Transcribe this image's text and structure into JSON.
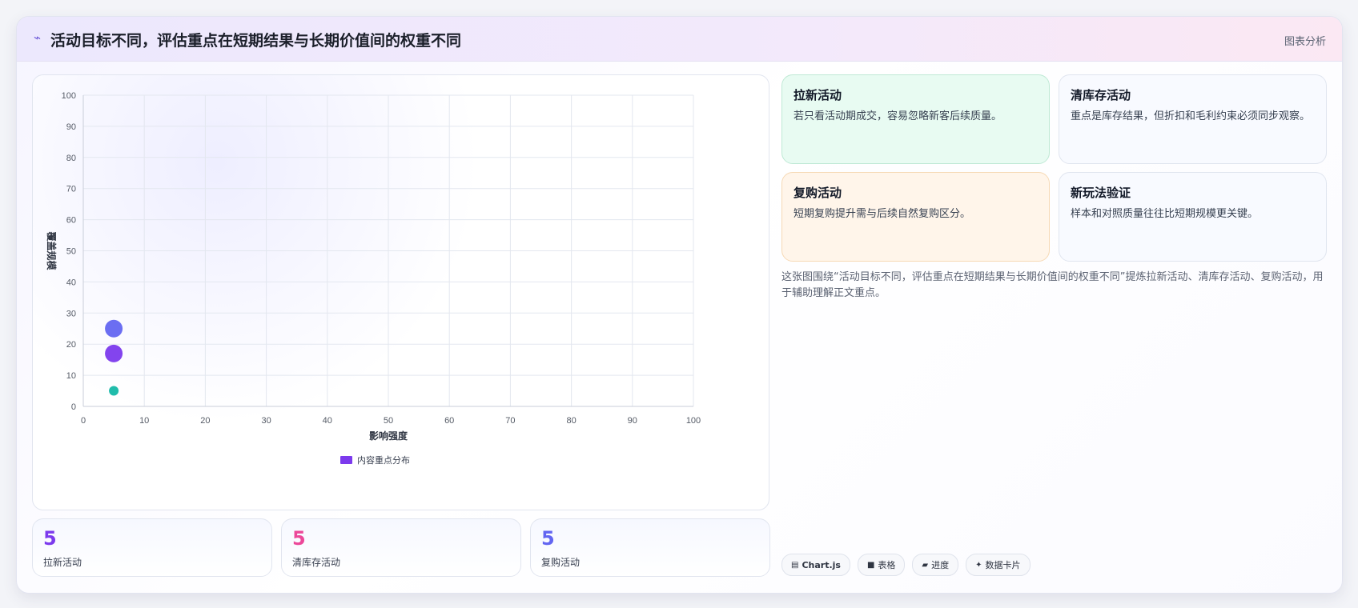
{
  "header": {
    "icon": "lightning-icon",
    "title": "活动目标不同，评估重点在短期结果与长期价值间的权重不同",
    "tag": "图表分析"
  },
  "chart_data": {
    "type": "scatter",
    "xlabel": "影响强度",
    "ylabel": "覆盖规模",
    "xlim": [
      0,
      100
    ],
    "ylim": [
      0,
      100
    ],
    "xticks": [
      0,
      10,
      20,
      30,
      40,
      50,
      60,
      70,
      80,
      90,
      100
    ],
    "yticks": [
      0,
      10,
      20,
      30,
      40,
      50,
      60,
      70,
      80,
      90,
      100
    ],
    "grid": true,
    "legend": {
      "position": "bottom",
      "entries": [
        "内容重点分布"
      ]
    },
    "series": [
      {
        "name": "内容重点分布",
        "points": [
          {
            "x": 5,
            "y": 25,
            "r": 11,
            "color": "#6366f1"
          },
          {
            "x": 5,
            "y": 17,
            "r": 11,
            "color": "#7c3aed"
          },
          {
            "x": 5,
            "y": 5,
            "r": 6,
            "color": "#14b8a6"
          }
        ]
      }
    ]
  },
  "stats": [
    {
      "value": "5",
      "label": "拉新活动",
      "color": "#7c3aed"
    },
    {
      "value": "5",
      "label": "清库存活动",
      "color": "#ec4899"
    },
    {
      "value": "5",
      "label": "复购活动",
      "color": "#6366f1"
    }
  ],
  "cards": [
    {
      "title": "拉新活动",
      "desc": "若只看活动期成交，容易忽略新客后续质量。",
      "bg": "#e8fbf2",
      "border": "#bfe9d5"
    },
    {
      "title": "清库存活动",
      "desc": "重点是库存结果，但折扣和毛利约束必须同步观察。",
      "bg": "#f8faff",
      "border": "#e0e5ef"
    },
    {
      "title": "复购活动",
      "desc": "短期复购提升需与后续自然复购区分。",
      "bg": "#fff5ea",
      "border": "#f6d9b5"
    },
    {
      "title": "新玩法验证",
      "desc": "样本和对照质量往往比短期规模更关键。",
      "bg": "#f8faff",
      "border": "#e0e5ef"
    }
  ],
  "description": "这张图围绕“活动目标不同，评估重点在短期结果与长期价值间的权重不同”提炼拉新活动、清库存活动、复购活动，用于辅助理解正文重点。",
  "pills": [
    {
      "icon": "chart-icon",
      "glyph": "▤",
      "label": "Chart.js",
      "bold": true
    },
    {
      "icon": "table-icon",
      "glyph": "■",
      "label": "表格",
      "bold": false
    },
    {
      "icon": "progress-icon",
      "glyph": "▰",
      "label": "进度",
      "bold": false
    },
    {
      "icon": "sparkle-icon",
      "glyph": "✦",
      "label": "数据卡片",
      "bold": false
    }
  ]
}
